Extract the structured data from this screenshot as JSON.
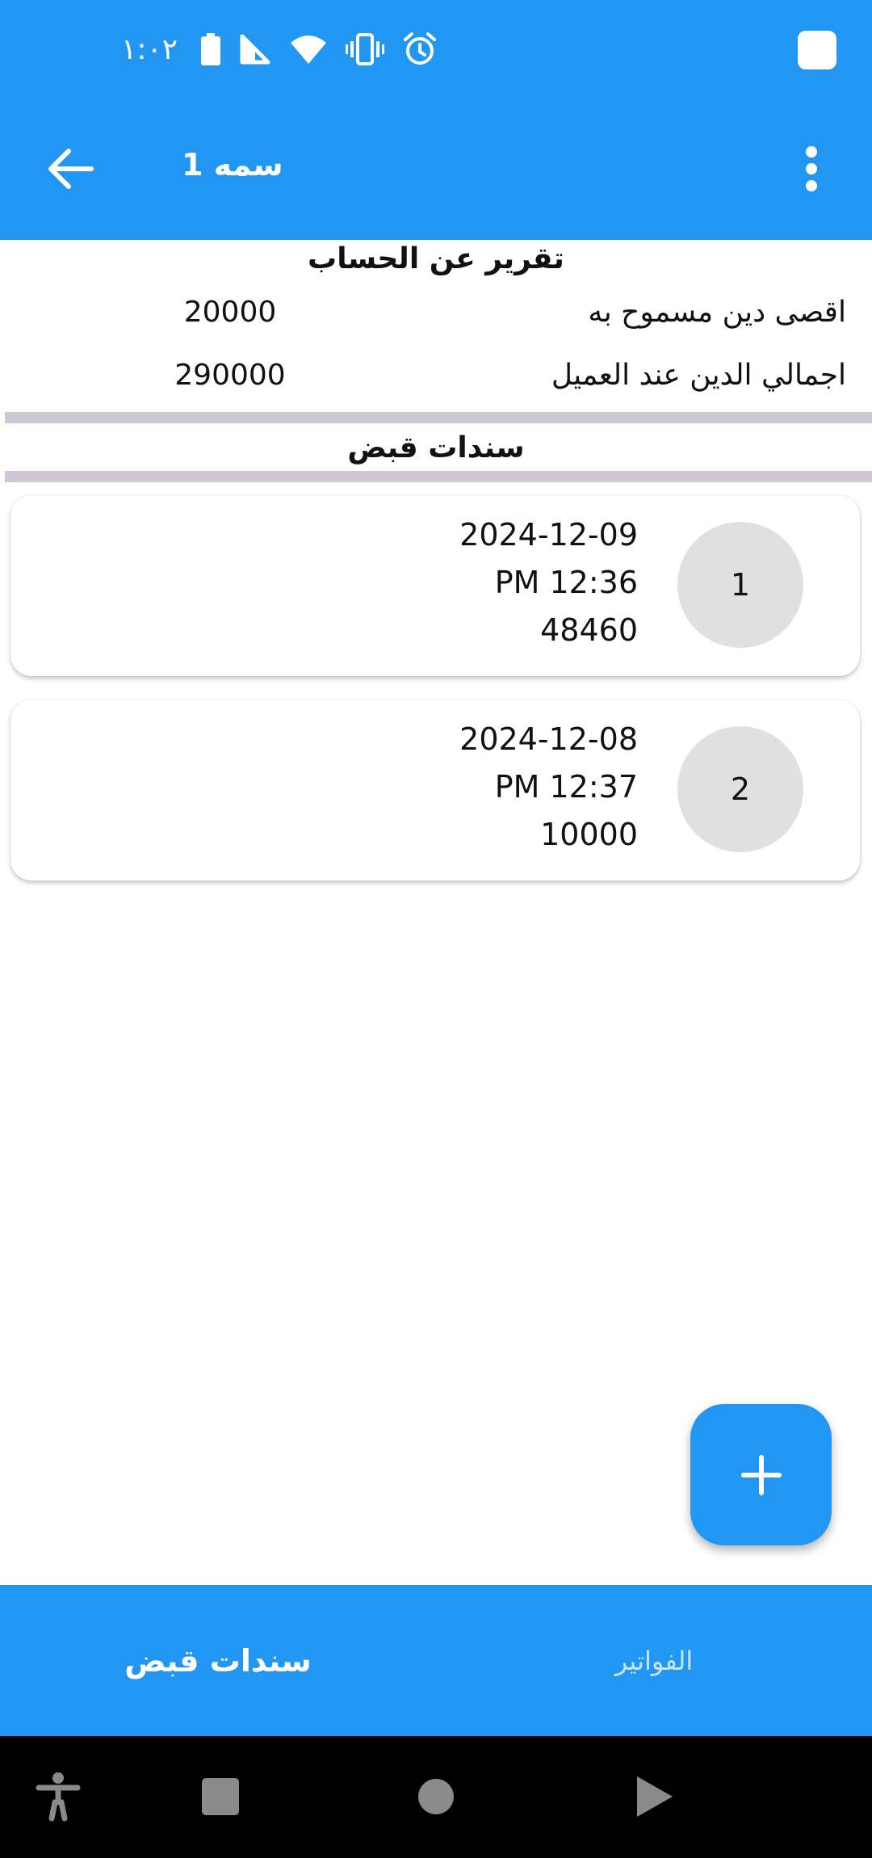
{
  "status_bar": {
    "time": "١:٠٢",
    "icons": [
      "battery-icon",
      "signal-icon",
      "wifi-icon",
      "vibrate-icon",
      "alarm-icon"
    ]
  },
  "app_bar": {
    "title": "سمه 1",
    "back_icon": "arrow-back-icon",
    "menu_icon": "more-vert-icon"
  },
  "report": {
    "title": "تقرير عن الحساب",
    "rows": [
      {
        "label": "اقصى دين مسموح به",
        "value": "20000"
      },
      {
        "label": "اجمالي الدين عند العميل",
        "value": "290000"
      }
    ]
  },
  "section": {
    "title": "سندات قبض"
  },
  "receipts": [
    {
      "number": "1",
      "date": "2024-12-09",
      "time": "PM 12:36",
      "amount": "48460"
    },
    {
      "number": "2",
      "date": "2024-12-08",
      "time": "PM 12:37",
      "amount": "10000"
    }
  ],
  "fab": {
    "icon": "plus-icon"
  },
  "bottom_nav": {
    "items": [
      {
        "label": "سندات قبض",
        "active": true
      },
      {
        "label": "الفواتير",
        "active": false
      }
    ]
  },
  "system_nav": {
    "icons": [
      "accessibility-icon",
      "recents-icon",
      "home-icon",
      "back-triangle-icon"
    ]
  },
  "colors": {
    "primary": "#2196F3",
    "divider": "#CFC8D4",
    "avatar": "#E0E0E0"
  }
}
